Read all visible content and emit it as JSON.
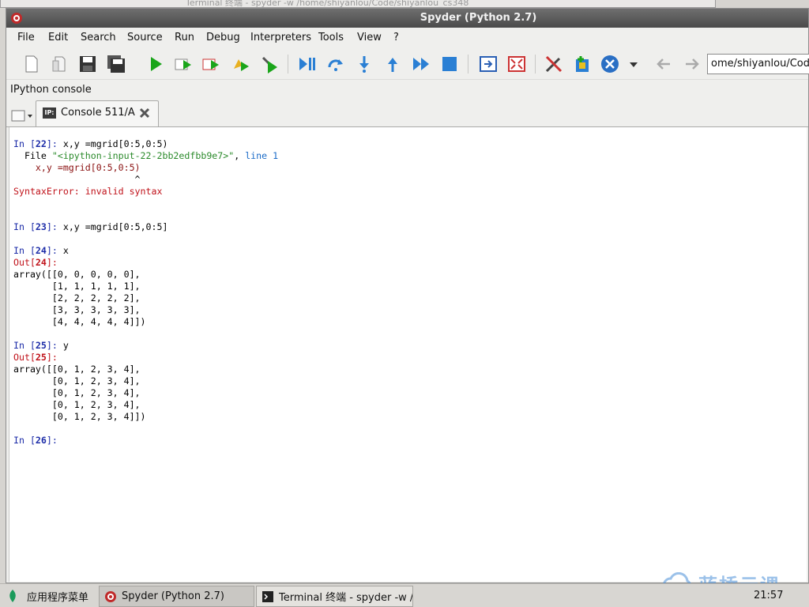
{
  "background_window": {
    "title": "Terminal 终端 - spyder -w /home/shiyanlou/Code/shiyanlou_cs348"
  },
  "window": {
    "title": "Spyder (Python 2.7)"
  },
  "menu": [
    "File",
    "Edit",
    "Search",
    "Source",
    "Run",
    "Debug",
    "Interpreters",
    "Tools",
    "View",
    "?"
  ],
  "toolbar": {
    "path_value": "ome/shiyanlou/Code/",
    "icons": [
      "new-file-icon",
      "open-file-icon",
      "save-icon",
      "save-all-icon",
      "run-icon",
      "run-config-icon",
      "rerun-icon",
      "run-selection-icon",
      "debug-icon",
      "debug-continue-icon",
      "step-over-icon",
      "step-into-icon",
      "step-return-icon",
      "continue-icon",
      "stop-icon",
      "maximize-pane-icon",
      "fullscreen-icon",
      "tools-icon",
      "python-path-icon",
      "preferences-icon",
      "back-icon",
      "forward-icon"
    ]
  },
  "pane": {
    "title": "IPython console"
  },
  "tab": {
    "icon_text": "IP:",
    "label": "Console 511/A"
  },
  "console": {
    "lines": [
      {
        "kind": "in",
        "prefix": "In [",
        "num": "22",
        "suffix": "]: ",
        "text": "x,y =mgrid[0:5,0:5)"
      },
      {
        "kind": "tbfile",
        "text1": "  File ",
        "file": "\"<ipython-input-22-2bb2edfbb9e7>\"",
        "text2": ", ",
        "line": "line 1"
      },
      {
        "kind": "errcode",
        "text": "    x,y =mgrid[0:5,0:5)"
      },
      {
        "kind": "plain",
        "text": "                      ^"
      },
      {
        "kind": "err",
        "text": "SyntaxError: invalid syntax"
      },
      {
        "kind": "blank",
        "text": ""
      },
      {
        "kind": "blank",
        "text": ""
      },
      {
        "kind": "in",
        "prefix": "In [",
        "num": "23",
        "suffix": "]: ",
        "text": "x,y =mgrid[0:5,0:5]"
      },
      {
        "kind": "blank",
        "text": ""
      },
      {
        "kind": "in",
        "prefix": "In [",
        "num": "24",
        "suffix": "]: ",
        "text": "x"
      },
      {
        "kind": "out",
        "prefix": "Out[",
        "num": "24",
        "suffix": "]:"
      },
      {
        "kind": "plain",
        "text": "array([[0, 0, 0, 0, 0],"
      },
      {
        "kind": "plain",
        "text": "       [1, 1, 1, 1, 1],"
      },
      {
        "kind": "plain",
        "text": "       [2, 2, 2, 2, 2],"
      },
      {
        "kind": "plain",
        "text": "       [3, 3, 3, 3, 3],"
      },
      {
        "kind": "plain",
        "text": "       [4, 4, 4, 4, 4]])"
      },
      {
        "kind": "blank",
        "text": ""
      },
      {
        "kind": "in",
        "prefix": "In [",
        "num": "25",
        "suffix": "]: ",
        "text": "y"
      },
      {
        "kind": "out",
        "prefix": "Out[",
        "num": "25",
        "suffix": "]:"
      },
      {
        "kind": "plain",
        "text": "array([[0, 1, 2, 3, 4],"
      },
      {
        "kind": "plain",
        "text": "       [0, 1, 2, 3, 4],"
      },
      {
        "kind": "plain",
        "text": "       [0, 1, 2, 3, 4],"
      },
      {
        "kind": "plain",
        "text": "       [0, 1, 2, 3, 4],"
      },
      {
        "kind": "plain",
        "text": "       [0, 1, 2, 3, 4]])"
      },
      {
        "kind": "blank",
        "text": ""
      },
      {
        "kind": "in",
        "prefix": "In [",
        "num": "26",
        "suffix": "]: ",
        "text": ""
      }
    ]
  },
  "taskbar": {
    "start_label": "应用程序菜单",
    "tasks": [
      {
        "label": "Spyder (Python 2.7)",
        "active": true
      },
      {
        "label": "Terminal 终端 - spyder -w /…",
        "active": false
      }
    ],
    "clock": "21:57"
  },
  "watermark": {
    "text": "蓝桥云课"
  },
  "colors": {
    "accent": "#1c2ca8",
    "error": "#c0121a",
    "titlebar": "#4a4a4a"
  }
}
